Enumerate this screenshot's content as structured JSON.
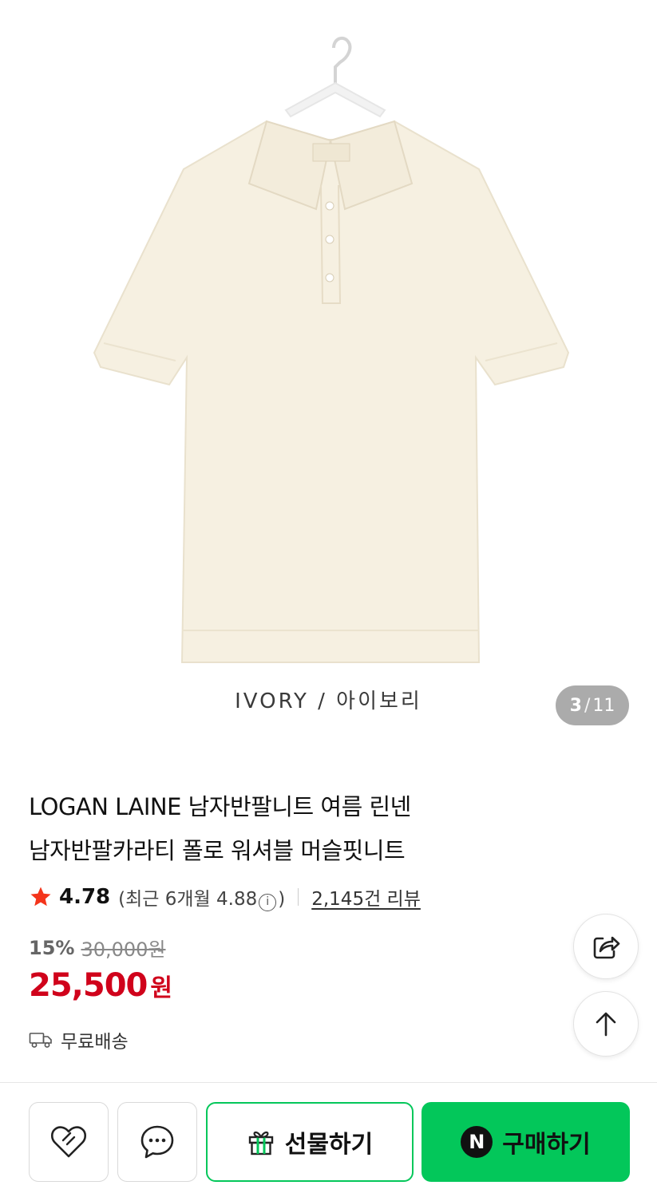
{
  "gallery": {
    "color_caption": "IVORY / 아이보리",
    "counter_current": "3",
    "counter_separator": "/",
    "counter_total": "11"
  },
  "product": {
    "title_line1": "LOGAN LAINE 남자반팔니트 여름 린넨",
    "title_line2": "남자반팔카라티 폴로 워셔블 머슬핏니트"
  },
  "rating": {
    "score": "4.78",
    "recent_prefix": "(최근 6개월 4.88",
    "info_symbol": "i",
    "recent_suffix": ")",
    "reviews": "2,145건 리뷰",
    "star_color": "#f4351b"
  },
  "price": {
    "discount_rate": "15%",
    "original": "30,000원",
    "sale": "25,500",
    "currency": "원",
    "sale_color": "#d0021b"
  },
  "shipping": {
    "label": "무료배송"
  },
  "bottom_bar": {
    "gift_label": "선물하기",
    "buy_label": "구매하기",
    "buy_badge": "N",
    "brand_color": "#03c75a"
  },
  "icons": {
    "wish": "heart-outline-icon",
    "chat": "chat-bubble-icon",
    "gift": "gift-box-icon",
    "share": "share-icon",
    "scroll_top": "arrow-up-icon",
    "truck": "truck-icon"
  }
}
